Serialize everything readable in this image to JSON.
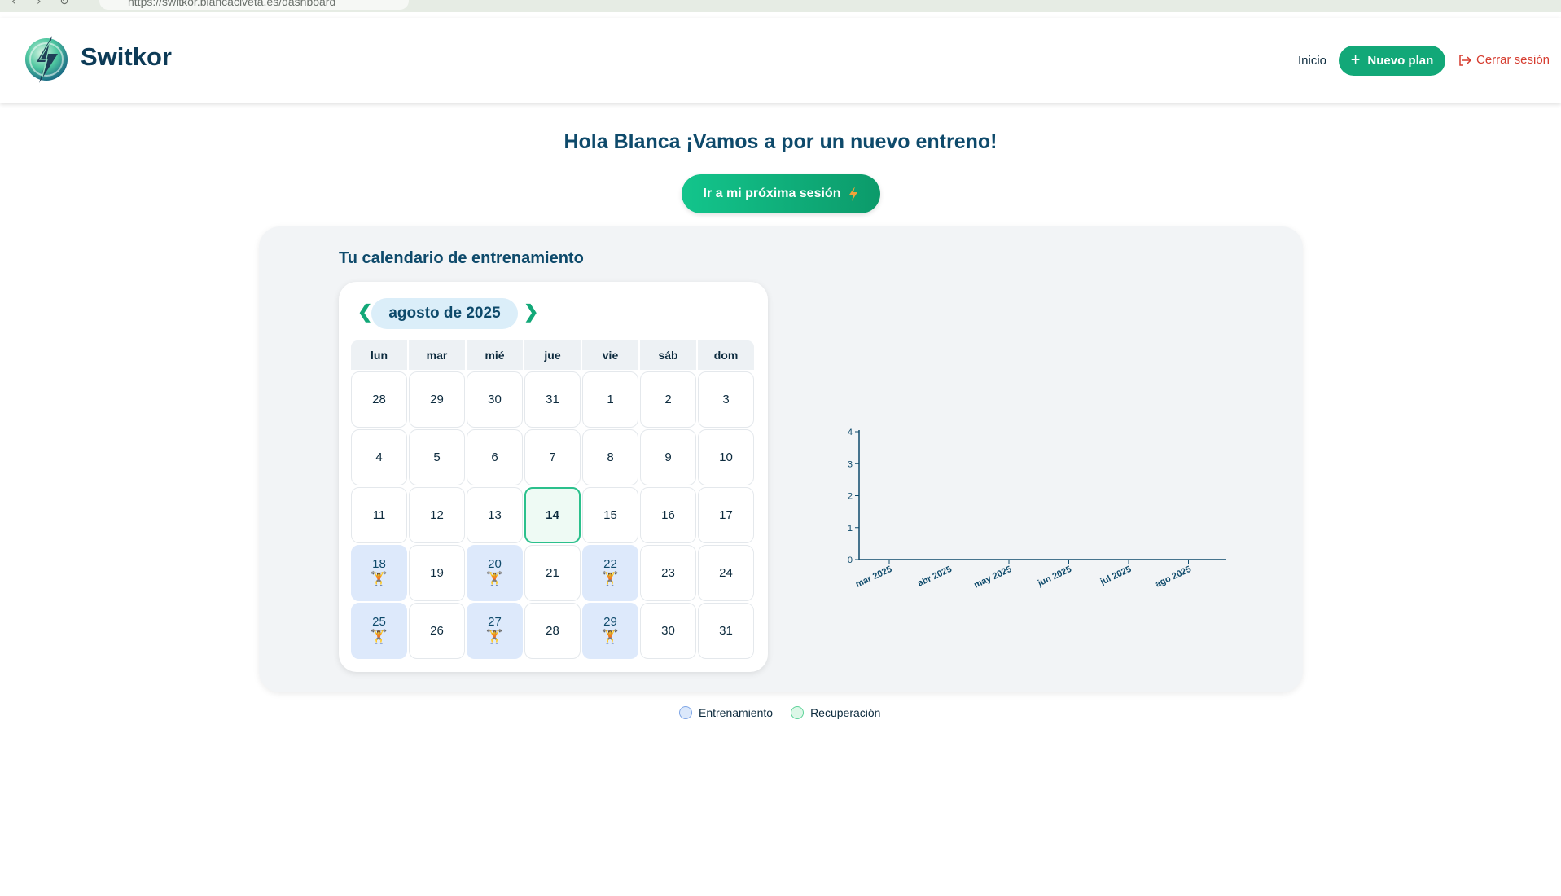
{
  "browser": {
    "url": "https://switkor.blancaclveta.es/dashboard"
  },
  "header": {
    "brand": "Switkor",
    "nav_home": "Inicio",
    "new_plan_label": "Nuevo plan",
    "logout_label": "Cerrar sesión"
  },
  "greeting": "Hola Blanca ¡Vamos a por un nuevo entreno!",
  "next_session_label": "Ir a mi próxima sesión",
  "calendar": {
    "title": "Tu calendario de entrenamiento",
    "prev": "❮",
    "next": "❯",
    "month_label": "agosto de 2025",
    "weekdays": [
      "lun",
      "mar",
      "mié",
      "jue",
      "vie",
      "sáb",
      "dom"
    ],
    "today": "14",
    "days": [
      {
        "n": "28"
      },
      {
        "n": "29"
      },
      {
        "n": "30"
      },
      {
        "n": "31"
      },
      {
        "n": "1"
      },
      {
        "n": "2"
      },
      {
        "n": "3"
      },
      {
        "n": "4"
      },
      {
        "n": "5"
      },
      {
        "n": "6"
      },
      {
        "n": "7"
      },
      {
        "n": "8"
      },
      {
        "n": "9"
      },
      {
        "n": "10"
      },
      {
        "n": "11"
      },
      {
        "n": "12"
      },
      {
        "n": "13"
      },
      {
        "n": "14",
        "today": true
      },
      {
        "n": "15"
      },
      {
        "n": "16"
      },
      {
        "n": "17"
      },
      {
        "n": "18",
        "training": true
      },
      {
        "n": "19"
      },
      {
        "n": "20",
        "training": true
      },
      {
        "n": "21"
      },
      {
        "n": "22",
        "training": true
      },
      {
        "n": "23"
      },
      {
        "n": "24"
      },
      {
        "n": "25",
        "training": true
      },
      {
        "n": "26"
      },
      {
        "n": "27",
        "training": true
      },
      {
        "n": "28"
      },
      {
        "n": "29",
        "training": true
      },
      {
        "n": "30"
      },
      {
        "n": "31"
      }
    ],
    "training_icon": "weightlifter-icon"
  },
  "chart_data": {
    "type": "bar",
    "categories": [
      "mar 2025",
      "abr 2025",
      "may 2025",
      "jun 2025",
      "jul 2025",
      "ago 2025"
    ],
    "series": [
      {
        "values": [
          0,
          0,
          0,
          0,
          0,
          0
        ]
      }
    ],
    "ylim": [
      0,
      4
    ],
    "yticks": [
      "0",
      "1",
      "2",
      "3",
      "4"
    ],
    "title": "",
    "xlabel": "",
    "ylabel": "",
    "grid": false
  },
  "legend": {
    "items": [
      {
        "label": "Entrenamiento",
        "fill": "#dbe8fb",
        "border": "#7fa6e6"
      },
      {
        "label": "Recuperación",
        "fill": "#dcf7e7",
        "border": "#5fd39a"
      }
    ]
  },
  "colors": {
    "accent": "#12a878",
    "danger": "#d63c2f",
    "primary_text": "#0e4a6b",
    "training_bg": "#dde9fb"
  }
}
